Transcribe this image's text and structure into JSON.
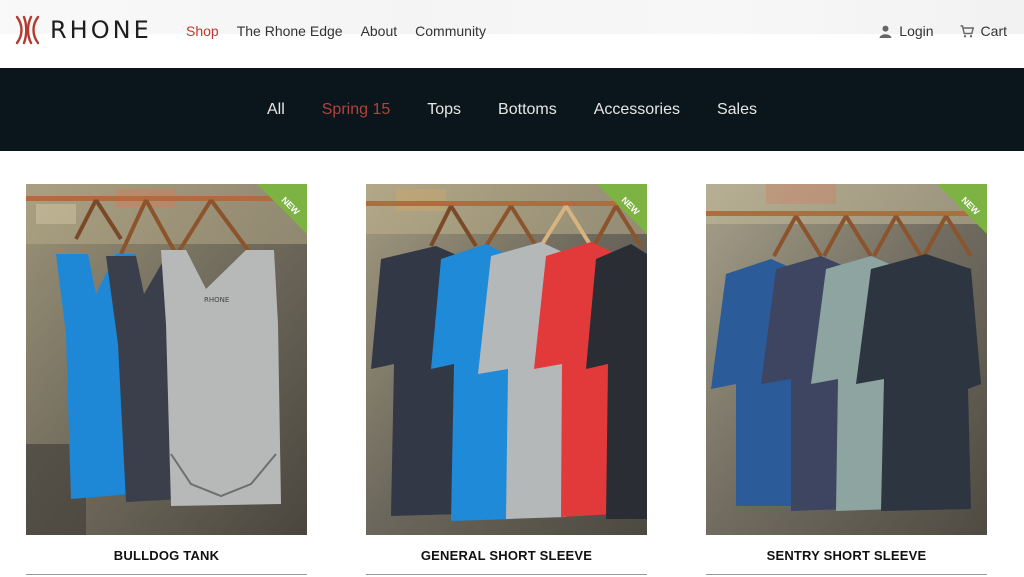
{
  "brand": {
    "name": "RHONE",
    "accent": "#c0392b"
  },
  "main_nav": [
    {
      "label": "Shop",
      "active": true
    },
    {
      "label": "The Rhone Edge",
      "active": false
    },
    {
      "label": "About",
      "active": false
    },
    {
      "label": "Community",
      "active": false
    }
  ],
  "user_nav": {
    "login": {
      "label": "Login",
      "icon": "user-icon"
    },
    "cart": {
      "label": "Cart",
      "icon": "cart-icon"
    }
  },
  "category_nav": [
    {
      "label": "All",
      "active": false
    },
    {
      "label": "Spring 15",
      "active": true
    },
    {
      "label": "Tops",
      "active": false
    },
    {
      "label": "Bottoms",
      "active": false
    },
    {
      "label": "Accessories",
      "active": false
    },
    {
      "label": "Sales",
      "active": false
    }
  ],
  "products": [
    {
      "name": "BULLDOG TANK",
      "badge": "NEW"
    },
    {
      "name": "GENERAL SHORT SLEEVE",
      "badge": "NEW"
    },
    {
      "name": "SENTRY SHORT SLEEVE",
      "badge": "NEW"
    }
  ],
  "colors": {
    "nav_bar": "#0b161c",
    "active_category": "#b3423b",
    "badge_green": "#7cb342"
  }
}
